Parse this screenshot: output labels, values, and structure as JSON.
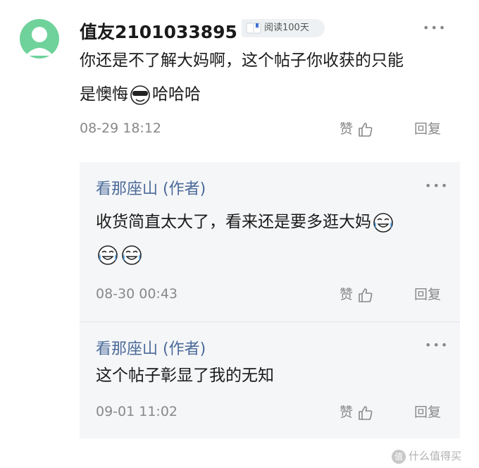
{
  "comment": {
    "username": "值友2101033895",
    "badge_text": "阅读100天",
    "text_line1": "你还是不了解大妈啊，这个帖子你收获的只能",
    "text_line2": "是懊悔",
    "text_line2_suffix": "哈哈哈",
    "timestamp": "08-29 18:12",
    "like_label": "赞",
    "reply_label": "回复"
  },
  "replies": [
    {
      "author": "看那座山 (作者)",
      "text_line1": "收货简直太大了，看来还是要多逛大妈",
      "timestamp": "08-30 00:43",
      "like_label": "赞",
      "reply_label": "回复"
    },
    {
      "author": "看那座山 (作者)",
      "text_line1": "这个帖子彰显了我的无知",
      "timestamp": "09-01 11:02",
      "like_label": "赞",
      "reply_label": "回复"
    }
  ],
  "more_glyph": "•••",
  "watermark": "什么值得买",
  "icons": [
    "avatar-placeholder-icon",
    "book-badge-icon",
    "more-icon",
    "thumbs-up-icon",
    "emoji-sunglasses-icon",
    "emoji-crying-laugh-icon",
    "watermark-logo-icon"
  ],
  "colors": {
    "avatar": "#6fd29b",
    "author_link": "#4a6a99",
    "reply_bg": "#f5f6f8",
    "muted": "#888888"
  }
}
